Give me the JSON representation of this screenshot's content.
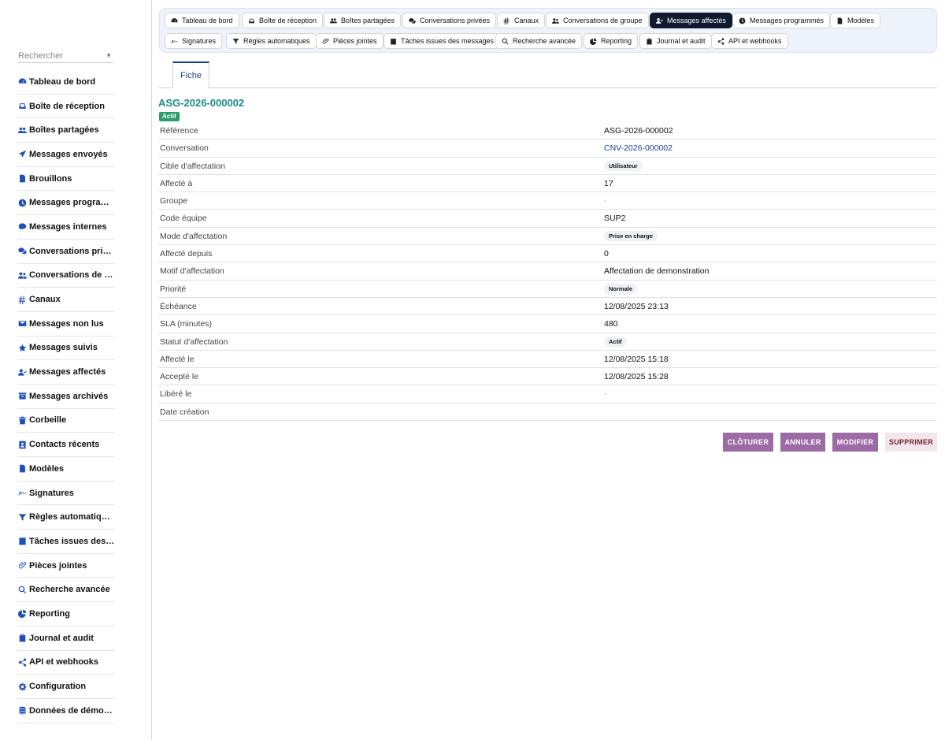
{
  "sidebar": {
    "search_placeholder": "Rechercher",
    "items": [
      {
        "label": "Tableau de bord",
        "icon": "dashboard-icon"
      },
      {
        "label": "Boîte de réception",
        "icon": "inbox-icon"
      },
      {
        "label": "Boîtes partagées",
        "icon": "users-icon"
      },
      {
        "label": "Messages envoyés",
        "icon": "send-icon"
      },
      {
        "label": "Brouillons",
        "icon": "file-icon"
      },
      {
        "label": "Messages programmés",
        "icon": "clock-icon"
      },
      {
        "label": "Messages internes",
        "icon": "comment-icon"
      },
      {
        "label": "Conversations privées",
        "icon": "comments-icon"
      },
      {
        "label": "Conversations de groupe",
        "icon": "user-group-icon"
      },
      {
        "label": "Canaux",
        "icon": "hashtag-icon"
      },
      {
        "label": "Messages non lus",
        "icon": "envelope-icon"
      },
      {
        "label": "Messages suivis",
        "icon": "star-icon"
      },
      {
        "label": "Messages affectés",
        "icon": "user-check-icon"
      },
      {
        "label": "Messages archivés",
        "icon": "archive-icon"
      },
      {
        "label": "Corbeille",
        "icon": "trash-icon"
      },
      {
        "label": "Contacts récents",
        "icon": "contact-icon"
      },
      {
        "label": "Modèles",
        "icon": "template-icon"
      },
      {
        "label": "Signatures",
        "icon": "signature-icon"
      },
      {
        "label": "Règles automatiques",
        "icon": "filter-icon"
      },
      {
        "label": "Tâches issues des messages",
        "icon": "tasks-icon"
      },
      {
        "label": "Pièces jointes",
        "icon": "paperclip-icon"
      },
      {
        "label": "Recherche avancée",
        "icon": "search-icon"
      },
      {
        "label": "Reporting",
        "icon": "pie-chart-icon"
      },
      {
        "label": "Journal et audit",
        "icon": "clipboard-icon"
      },
      {
        "label": "API et webhooks",
        "icon": "share-icon"
      },
      {
        "label": "Configuration",
        "icon": "gear-icon"
      },
      {
        "label": "Données de démonstration",
        "icon": "database-icon"
      }
    ]
  },
  "topbar": {
    "tabs": [
      {
        "label": "Tableau de bord",
        "icon": "dashboard-icon"
      },
      {
        "label": "Boîte de réception",
        "icon": "inbox-icon"
      },
      {
        "label": "Boîtes partagées",
        "icon": "users-icon"
      },
      {
        "label": "Conversations privées",
        "icon": "comments-icon"
      },
      {
        "label": "Canaux",
        "icon": "hashtag-icon"
      },
      {
        "label": "Conversations de groupe",
        "icon": "user-group-icon"
      },
      {
        "label": "Messages affectés",
        "icon": "user-check-icon",
        "active": true
      },
      {
        "label": "Messages programmés",
        "icon": "clock-icon"
      },
      {
        "label": "Modèles",
        "icon": "template-icon"
      },
      {
        "label": "Signatures",
        "icon": "signature-icon"
      },
      {
        "label": "Règles automatiques",
        "icon": "filter-icon"
      },
      {
        "label": "Pièces jointes",
        "icon": "paperclip-icon"
      },
      {
        "label": "Tâches issues des messages",
        "icon": "tasks-icon"
      },
      {
        "label": "Recherche avancée",
        "icon": "search-icon"
      },
      {
        "label": "Reporting",
        "icon": "pie-chart-icon"
      },
      {
        "label": "Journal et audit",
        "icon": "clipboard-icon"
      },
      {
        "label": "API et webhooks",
        "icon": "share-icon"
      }
    ]
  },
  "record": {
    "tab_label": "Fiche",
    "title": "ASG-2026-000002",
    "status_badge": "Actif",
    "fields": [
      {
        "label": "Référence",
        "value": "ASG-2026-000002",
        "kind": "text"
      },
      {
        "label": "Conversation",
        "value": "CNV-2026-000002",
        "kind": "link"
      },
      {
        "label": "Cible d'affectation",
        "value": "Utilisateur",
        "kind": "chip"
      },
      {
        "label": "Affecté à",
        "value": "17",
        "kind": "text"
      },
      {
        "label": "Groupe",
        "value": "-",
        "kind": "dash"
      },
      {
        "label": "Code équipe",
        "value": "SUP2",
        "kind": "text"
      },
      {
        "label": "Mode d'affectation",
        "value": "Prise en charge",
        "kind": "chip"
      },
      {
        "label": "Affecté depuis",
        "value": "0",
        "kind": "text"
      },
      {
        "label": "Motif d'affectation",
        "value": "Affectation de demonstration",
        "kind": "text"
      },
      {
        "label": "Priorité",
        "value": "Normale",
        "kind": "chip"
      },
      {
        "label": "Échéance",
        "value": "12/08/2025 23:13",
        "kind": "text"
      },
      {
        "label": "SLA (minutes)",
        "value": "480",
        "kind": "text"
      },
      {
        "label": "Statut d'affectation",
        "value": "Actif",
        "kind": "chip"
      },
      {
        "label": "Affecté le",
        "value": "12/08/2025 15:18",
        "kind": "text"
      },
      {
        "label": "Accepté le",
        "value": "12/08/2025 15:28",
        "kind": "text"
      },
      {
        "label": "Libéré le",
        "value": "-",
        "kind": "dash"
      },
      {
        "label": "Date création",
        "value": "",
        "kind": "text"
      }
    ]
  },
  "actions": {
    "close_label": "CLÔTURER",
    "cancel_label": "ANNULER",
    "edit_label": "MODIFIER",
    "delete_label": "SUPPRIMER"
  },
  "colors": {
    "accent": "#1e3f8f",
    "title": "#1a8a8a",
    "badge": "#2a9d6a",
    "action": "#9c6ba5",
    "active_tab": "#0f1a2e"
  }
}
